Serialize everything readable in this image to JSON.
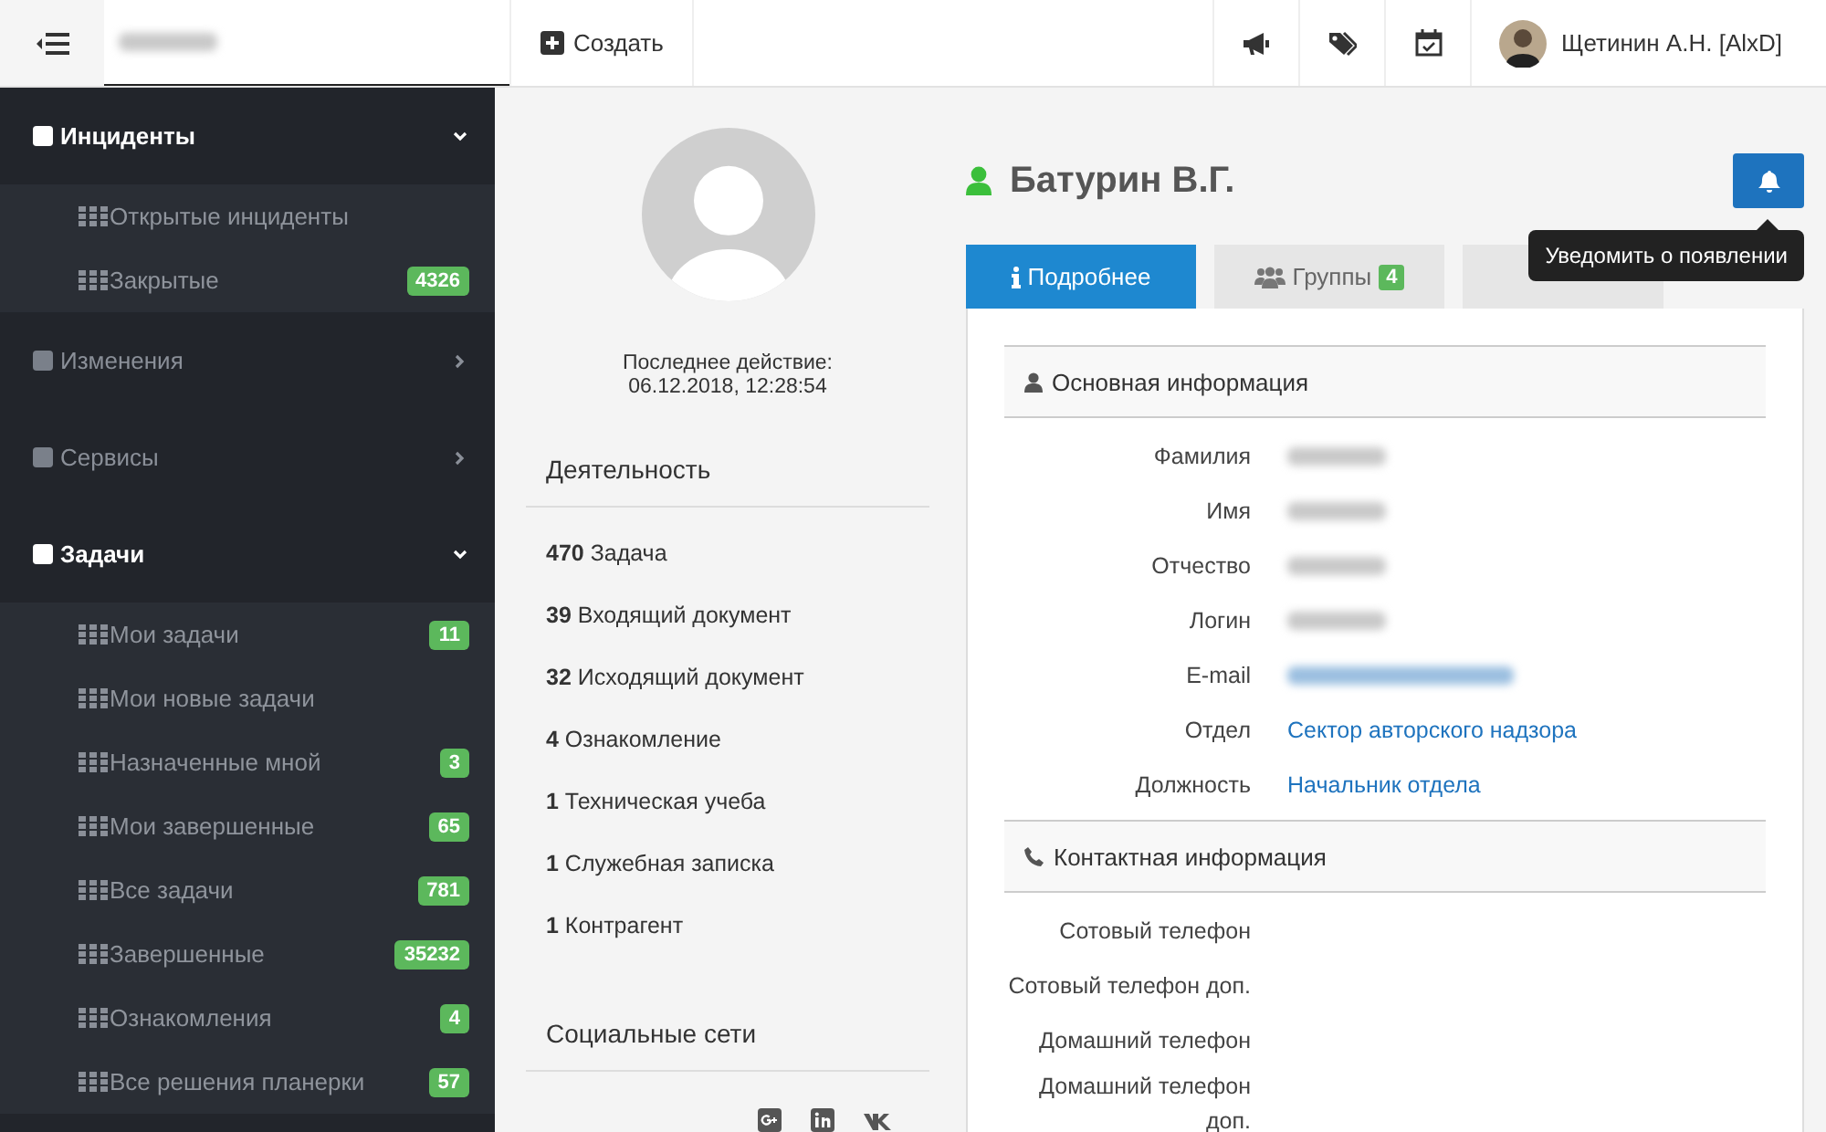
{
  "header": {
    "org_redacted": true,
    "create_label": "Создать",
    "user_name": "Щетинин А.Н. [AlxD]"
  },
  "sidebar": {
    "sections": [
      {
        "label": "Инциденты",
        "expanded": true,
        "children": [
          {
            "label": "Открытые инциденты"
          },
          {
            "label": "Закрытые",
            "badge": "4326"
          }
        ]
      },
      {
        "label": "Изменения",
        "expanded": false
      },
      {
        "label": "Сервисы",
        "expanded": false
      },
      {
        "label": "Задачи",
        "expanded": true,
        "children": [
          {
            "label": "Мои задачи",
            "badge": "11"
          },
          {
            "label": "Мои новые задачи"
          },
          {
            "label": "Назначенные мной",
            "badge": "3"
          },
          {
            "label": "Мои завершенные",
            "badge": "65"
          },
          {
            "label": "Все задачи",
            "badge": "781"
          },
          {
            "label": "Завершенные",
            "badge": "35232"
          },
          {
            "label": "Ознакомления",
            "badge": "4"
          },
          {
            "label": "Все решения планерки",
            "badge": "57"
          }
        ]
      }
    ]
  },
  "profile": {
    "last_action_label": "Последнее действие:",
    "last_action_time": "06.12.2018, 12:28:54",
    "activity_title": "Деятельность",
    "activity": [
      "**470** Задача",
      "**39** Входящий документ",
      "**32** Исходящий документ",
      "**4** Ознакомление",
      "**1** Техническая учеба",
      "**1** Служебная записка",
      "**1** Контрагент"
    ],
    "social_title": "Социальные сети",
    "social": [
      {
        "kind": "gplus"
      },
      {
        "kind": "linkedin"
      },
      {
        "kind": "vk"
      }
    ]
  },
  "person": {
    "name": "Батурин В.Г.",
    "online": true,
    "tooltip": "Уведомить о появлении"
  },
  "tabs": [
    {
      "label": "Подробнее",
      "selected": true
    },
    {
      "label": "Группы",
      "badge": "4",
      "selected": false
    },
    {
      "selected": false
    }
  ],
  "sections": [
    {
      "title": "Основная информация",
      "rows": [
        {
          "label": "Фамилия",
          "redacted": true
        },
        {
          "label": "Имя",
          "redacted": true
        },
        {
          "label": "Отчество",
          "redacted": true
        },
        {
          "label": "Логин",
          "redacted": true
        },
        {
          "label": "E-mail",
          "redacted": true,
          "link": true
        },
        {
          "label": "Отдел",
          "value": "Сектор авторского надзора",
          "link": true
        },
        {
          "label": "Должность",
          "value": "Начальник отдела",
          "link": true
        }
      ]
    },
    {
      "title": "Контактная информация",
      "rows": [
        {
          "label": "Сотовый телефон"
        },
        {
          "label": "Сотовый телефон доп."
        },
        {
          "label": "Домашний телефон"
        },
        {
          "label": "Домашний телефон доп."
        }
      ]
    }
  ]
}
